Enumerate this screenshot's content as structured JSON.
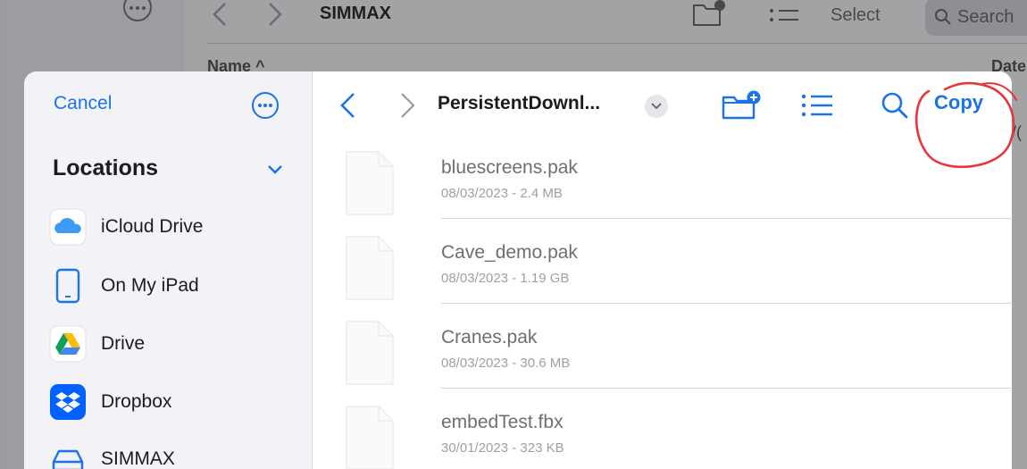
{
  "background": {
    "folder_title": "SIMMAX",
    "select_label": "Select",
    "search_label": "Search",
    "name_column": "Name ^",
    "date_column": "Date",
    "partial_date": "/("
  },
  "sidebar": {
    "cancel_label": "Cancel",
    "locations_title": "Locations",
    "items": [
      {
        "label": "iCloud Drive",
        "icon": "icloud-icon"
      },
      {
        "label": "On My iPad",
        "icon": "ipad-icon"
      },
      {
        "label": "Drive",
        "icon": "google-drive-icon"
      },
      {
        "label": "Dropbox",
        "icon": "dropbox-icon"
      },
      {
        "label": "SIMMAX",
        "icon": "external-drive-icon"
      }
    ]
  },
  "toolbar": {
    "folder_title": "PersistentDownl...",
    "copy_label": "Copy"
  },
  "files": [
    {
      "name": "bluescreens.pak",
      "meta": "08/03/2023 - 2.4 MB"
    },
    {
      "name": "Cave_demo.pak",
      "meta": "08/03/2023 - 1.19 GB"
    },
    {
      "name": "Cranes.pak",
      "meta": "08/03/2023 - 30.6 MB"
    },
    {
      "name": "embedTest.fbx",
      "meta": "30/01/2023 - 323 KB"
    }
  ],
  "colors": {
    "accent": "#1a73e8",
    "annotation": "#e8343a",
    "dim_overlay": "#9c9ca0"
  }
}
